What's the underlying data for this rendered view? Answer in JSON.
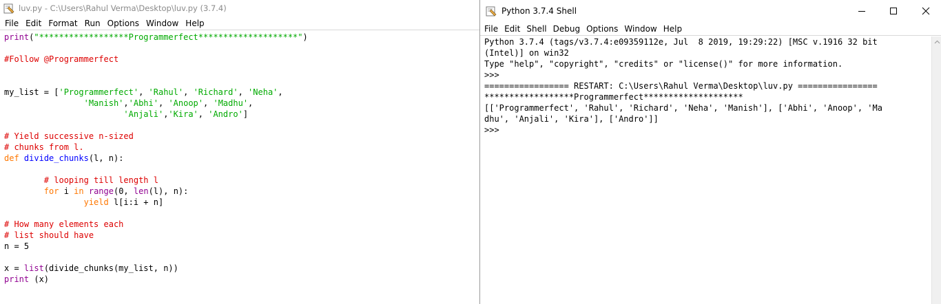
{
  "editor": {
    "title": "luv.py - C:\\Users\\Rahul Verma\\Desktop\\luv.py (3.7.4)",
    "menu": [
      "File",
      "Edit",
      "Format",
      "Run",
      "Options",
      "Window",
      "Help"
    ],
    "code": {
      "l1a": "print",
      "l1b": "(",
      "l1c": "\"******************Programmerfect********************\"",
      "l1d": ")",
      "l3": "#Follow @Programmerfect",
      "l6a": "my_list = [",
      "l6b": "'Programmerfect'",
      "l6c": ", ",
      "l6d": "'Rahul'",
      "l6e": ", ",
      "l6f": "'Richard'",
      "l6g": ", ",
      "l6h": "'Neha'",
      "l6i": ",",
      "l7a": "                ",
      "l7b": "'Manish'",
      "l7c": ",",
      "l7d": "'Abhi'",
      "l7e": ", ",
      "l7f": "'Anoop'",
      "l7g": ", ",
      "l7h": "'Madhu'",
      "l7i": ",",
      "l8a": "                        ",
      "l8b": "'Anjali'",
      "l8c": ",",
      "l8d": "'Kira'",
      "l8e": ", ",
      "l8f": "'Andro'",
      "l8g": "]",
      "l10": "# Yield successive n-sized",
      "l11": "# chunks from l.",
      "l12a": "def",
      "l12b": " ",
      "l12c": "divide_chunks",
      "l12d": "(l, n):",
      "l14a": "        ",
      "l14b": "# looping till length l",
      "l15a": "        ",
      "l15b": "for",
      "l15c": " i ",
      "l15d": "in",
      "l15e": " ",
      "l15f": "range",
      "l15g": "(0, ",
      "l15h": "len",
      "l15i": "(l), n):",
      "l16a": "                ",
      "l16b": "yield",
      "l16c": " l[i:i + n]",
      "l18": "# How many elements each",
      "l19": "# list should have",
      "l20": "n = 5",
      "l22a": "x = ",
      "l22b": "list",
      "l22c": "(divide_chunks(my_list, n))",
      "l23a": "print",
      "l23b": " (x)"
    }
  },
  "shell": {
    "title": "Python 3.7.4 Shell",
    "menu": [
      "File",
      "Edit",
      "Shell",
      "Debug",
      "Options",
      "Window",
      "Help"
    ],
    "lines": {
      "s1": "Python 3.7.4 (tags/v3.7.4:e09359112e, Jul  8 2019, 19:29:22) [MSC v.1916 32 bit",
      "s2": "(Intel)] on win32",
      "s3": "Type \"help\", \"copyright\", \"credits\" or \"license()\" for more information.",
      "s4": ">>> ",
      "s5": "================= RESTART: C:\\Users\\Rahul Verma\\Desktop\\luv.py ================",
      "s6": "******************Programmerfect********************",
      "s7": "[['Programmerfect', 'Rahul', 'Richard', 'Neha', 'Manish'], ['Abhi', 'Anoop', 'Ma",
      "s8": "dhu', 'Anjali', 'Kira'], ['Andro']]",
      "s9": ">>> "
    }
  },
  "icons": {
    "app": "python-idle-icon",
    "minimize": "minimize-icon",
    "maximize": "maximize-icon",
    "close": "close-icon",
    "scroll_up": "chevron-up-icon",
    "scroll_down": "chevron-down-icon"
  },
  "colors": {
    "keyword": "#ff7700",
    "string": "#00aa00",
    "comment": "#dd0000",
    "builtin": "#900090",
    "function": "#0000ff",
    "output": "#0000ff",
    "prompt": "#a52a2a"
  }
}
